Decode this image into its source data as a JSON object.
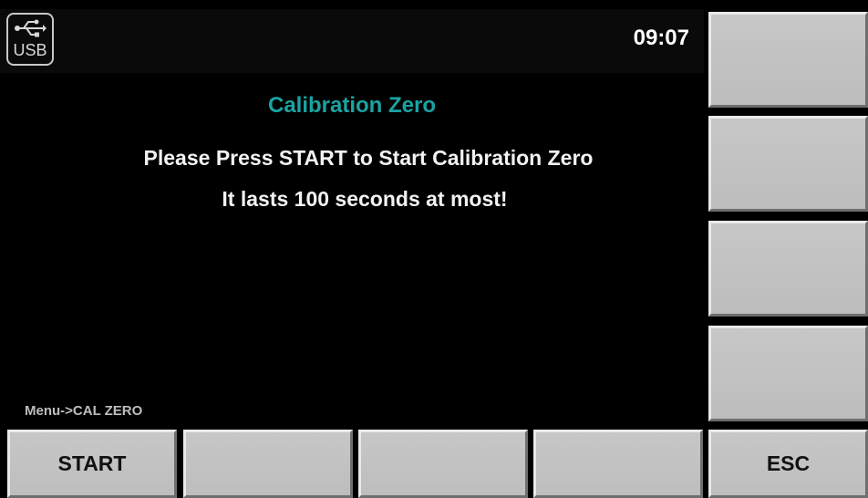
{
  "status_bar": {
    "usb_label": "USB",
    "time": "09:07"
  },
  "dialog": {
    "title": "Calibration Zero",
    "instruction": "Please Press START to Start Calibration Zero",
    "duration_note": "It lasts 100 seconds at most!"
  },
  "breadcrumb": "Menu->CAL ZERO",
  "side_keys": [
    "",
    "",
    "",
    ""
  ],
  "bottom_keys": [
    "START",
    "",
    "",
    "",
    "ESC"
  ],
  "colors": {
    "title": "#1aa3a3",
    "background": "#000000",
    "key_face": "#c4c4c4"
  }
}
